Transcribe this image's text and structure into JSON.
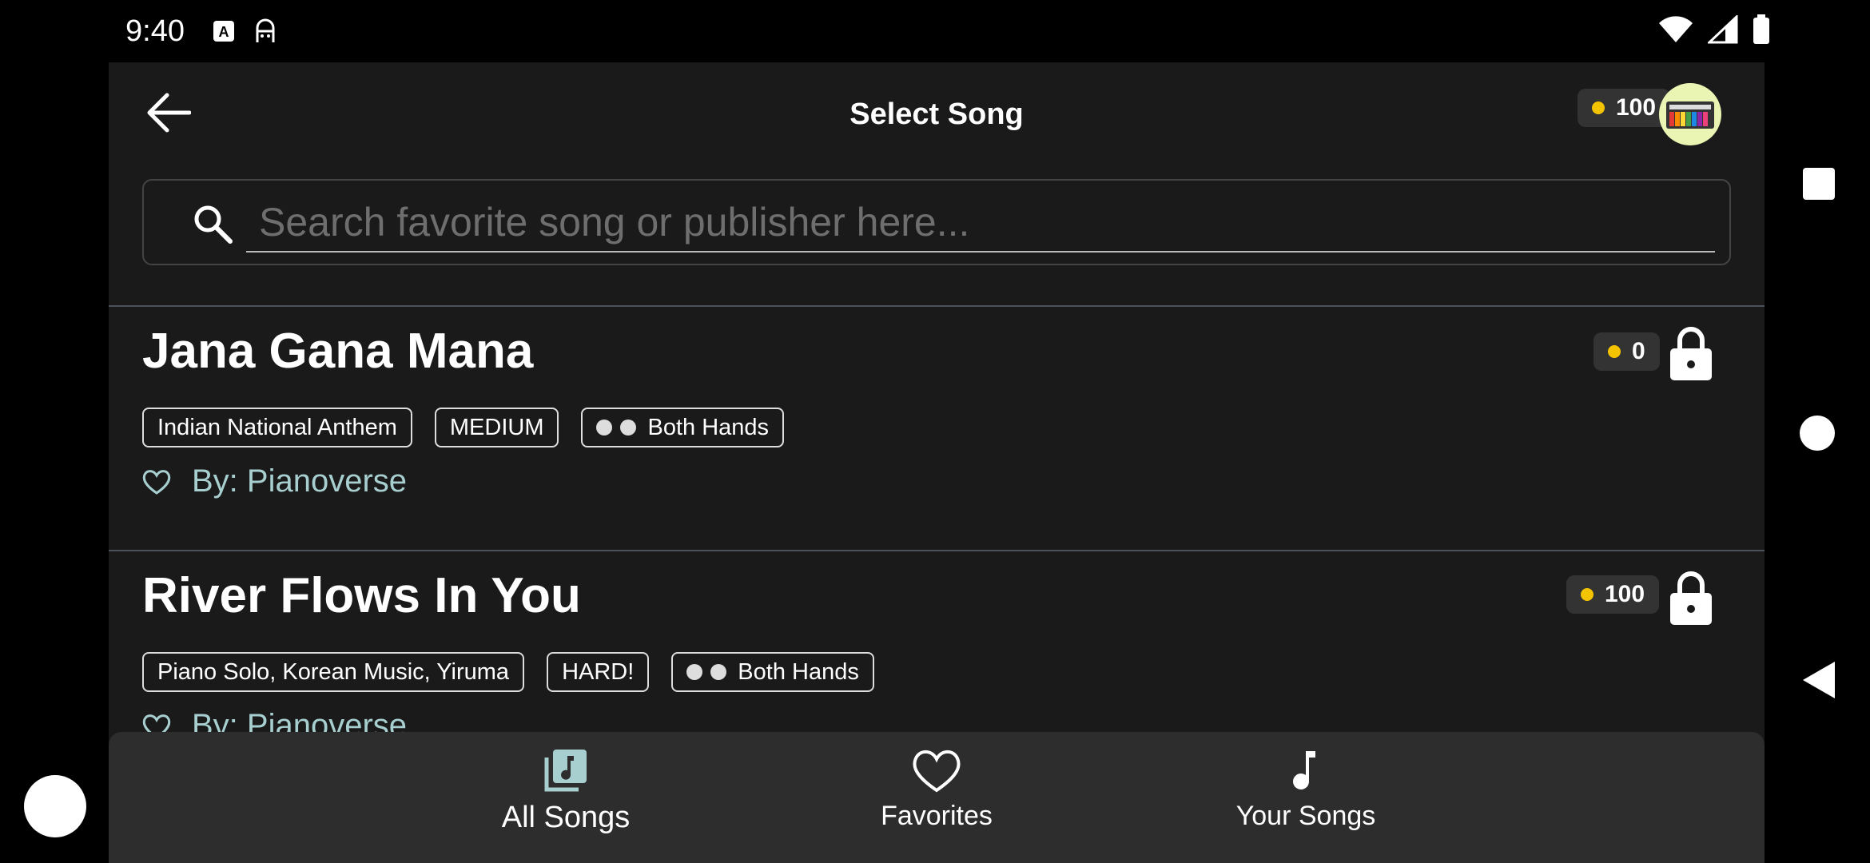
{
  "status_bar": {
    "time": "9:40",
    "icons": [
      "accessibility-icon",
      "ghost-icon",
      "wifi-icon",
      "cellular-icon",
      "battery-icon"
    ]
  },
  "header": {
    "title": "Select Song",
    "coins": "100"
  },
  "search": {
    "placeholder": "Search favorite song or publisher here..."
  },
  "songs": [
    {
      "title": "Jana Gana Mana",
      "coins": "0",
      "tags": [
        "Indian National Anthem",
        "MEDIUM"
      ],
      "hands": "Both Hands",
      "by_prefix": "By:",
      "publisher": "Pianoverse"
    },
    {
      "title": "River Flows In You",
      "coins": "100",
      "tags": [
        "Piano Solo, Korean Music, Yiruma",
        "HARD!"
      ],
      "hands": "Both Hands",
      "by_prefix": "By:",
      "publisher": "Pianoverse"
    }
  ],
  "bottom_nav": {
    "items": [
      {
        "label": "All Songs",
        "icon": "library-music-icon",
        "active": true
      },
      {
        "label": "Favorites",
        "icon": "heart-icon"
      },
      {
        "label": "Your Songs",
        "icon": "music-note-icon"
      }
    ]
  },
  "colors": {
    "coin": "#f5c400",
    "accent_teal": "#a8cfd0",
    "background": "#1a1a1a"
  }
}
